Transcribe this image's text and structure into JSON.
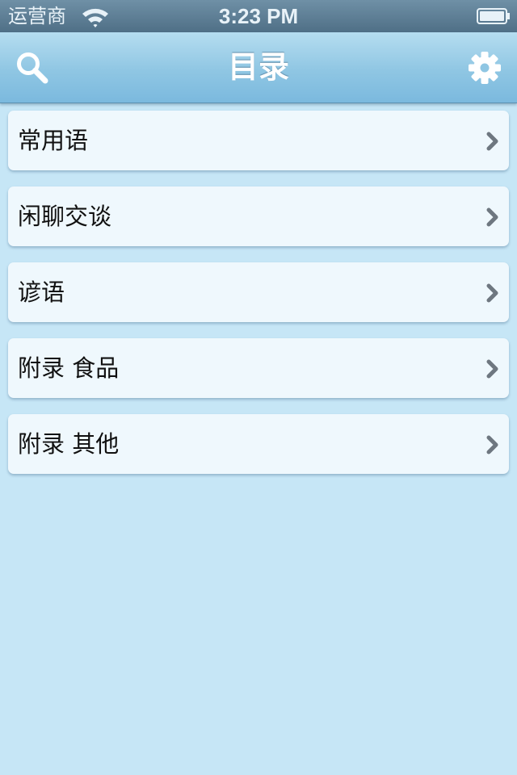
{
  "status_bar": {
    "carrier": "运营商",
    "time": "3:23 PM"
  },
  "nav_bar": {
    "title": "目录",
    "left_icon": "search-icon",
    "right_icon": "gear-icon"
  },
  "menu": {
    "items": [
      {
        "label": "常用语"
      },
      {
        "label": "闲聊交谈"
      },
      {
        "label": "谚语"
      },
      {
        "label": "附录 食品"
      },
      {
        "label": "附录 其他"
      }
    ]
  },
  "colors": {
    "background": "#c6e6f6",
    "nav_bar": "#8fc6e3",
    "row_background": "#eff8fd",
    "chevron": "#6e7780"
  }
}
